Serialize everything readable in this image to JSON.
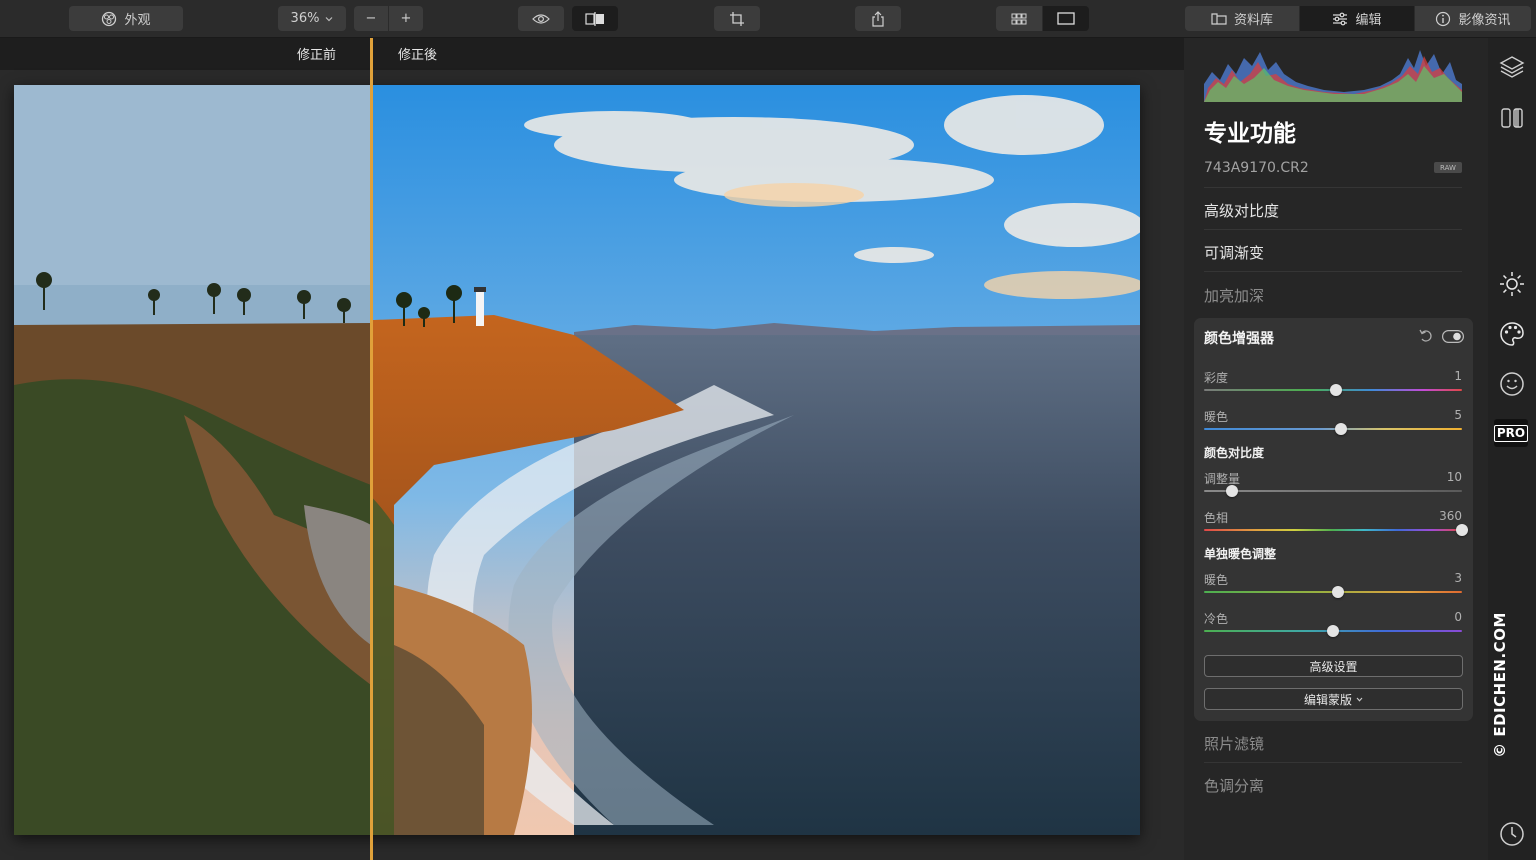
{
  "toolbar": {
    "appearance_label": "外观",
    "zoom_value": "36%",
    "zoom_out": "−",
    "zoom_in": "+"
  },
  "tabs": {
    "library": "资料库",
    "edit": "编辑",
    "info": "影像资讯"
  },
  "compare": {
    "before": "修正前",
    "after": "修正後"
  },
  "panel": {
    "title": "专业功能",
    "filename": "743A9170.CR2",
    "raw_badge": "RAW",
    "sections_top": [
      "高级对比度",
      "可调渐变",
      "加亮加深"
    ],
    "sections_bottom": [
      "照片滤镜",
      "色调分离"
    ],
    "enhancer": {
      "title": "颜色增强器",
      "saturation_label": "彩度",
      "saturation_value": "1",
      "saturation_pos": 0.51,
      "warmth_label": "暖色",
      "warmth_value": "5",
      "warmth_pos": 0.53,
      "color_contrast_head": "颜色对比度",
      "amount_label": "调整量",
      "amount_value": "10",
      "amount_pos": 0.11,
      "hue_label": "色相",
      "hue_value": "360",
      "hue_pos": 1.0,
      "single_warmth_head": "单独暖色调整",
      "warm_label": "暖色",
      "warm_value": "3",
      "warm_pos": 0.52,
      "cool_label": "冷色",
      "cool_value": "0",
      "cool_pos": 0.5,
      "advanced_button": "高级设置",
      "edit_mask_button": "编辑蒙版"
    }
  },
  "watermark": "© EDICHEN.COM",
  "colors": {
    "divider": "#e0a13a",
    "panel_bg": "#262626",
    "enhancer_bg": "#343434"
  }
}
